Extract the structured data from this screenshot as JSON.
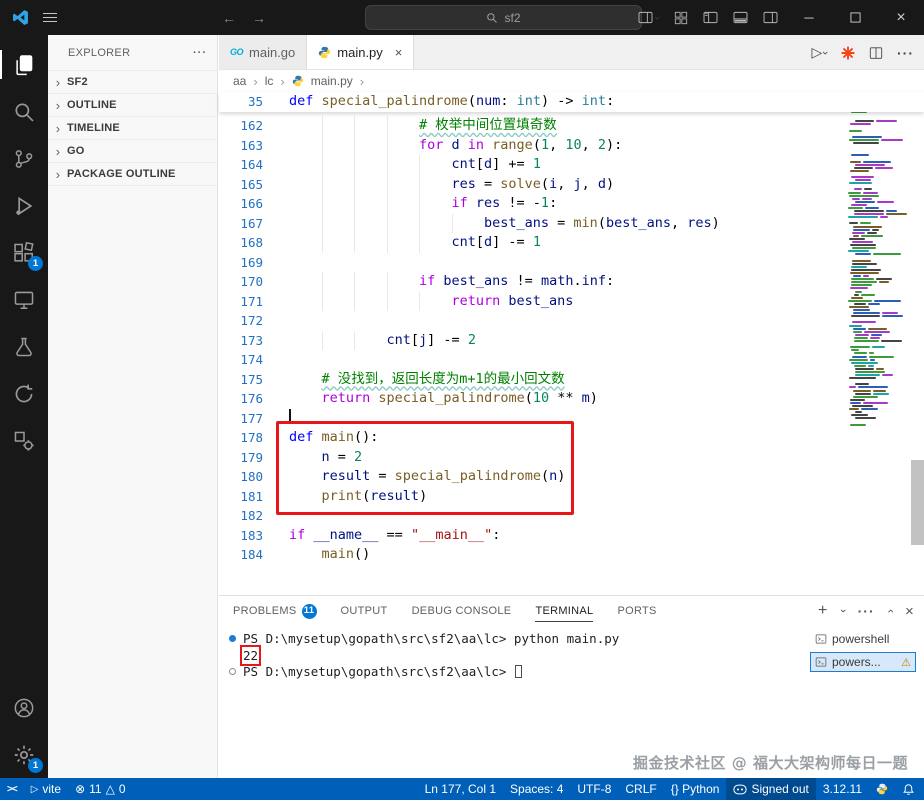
{
  "titlebar": {
    "search": "sf2"
  },
  "activity_bar": {
    "extensions_badge": "1",
    "settings_badge": "1"
  },
  "sidebar": {
    "title": "EXPLORER",
    "sections": [
      {
        "label": "SF2"
      },
      {
        "label": "OUTLINE"
      },
      {
        "label": "TIMELINE"
      },
      {
        "label": "GO"
      },
      {
        "label": "PACKAGE OUTLINE"
      }
    ]
  },
  "tabs": [
    {
      "label": "main.go",
      "icon": "go",
      "active": false
    },
    {
      "label": "main.py",
      "icon": "python",
      "active": true
    }
  ],
  "breadcrumb": {
    "items": [
      "aa",
      "lc",
      "main.py"
    ]
  },
  "editor": {
    "sticky": {
      "num": "35",
      "indent": 0,
      "tokens": [
        [
          "def ",
          "def"
        ],
        [
          "special_palindrome",
          "fn"
        ],
        [
          "(",
          "pl"
        ],
        [
          "num",
          "var"
        ],
        [
          ": ",
          "pl"
        ],
        [
          "int",
          "type"
        ],
        [
          ") ",
          "pl"
        ],
        [
          "-> ",
          "pl"
        ],
        [
          "int",
          "type"
        ],
        [
          ":",
          "pl"
        ]
      ]
    },
    "lines": [
      {
        "num": 162,
        "indent": 16,
        "tokens": [
          [
            "# 枚举中间位置填奇数",
            "com"
          ]
        ]
      },
      {
        "num": 163,
        "indent": 16,
        "tokens": [
          [
            "for ",
            "kw"
          ],
          [
            "d",
            "var"
          ],
          [
            " in ",
            "kw"
          ],
          [
            "range",
            "fn"
          ],
          [
            "(",
            "pl"
          ],
          [
            "1",
            "num"
          ],
          [
            ", ",
            "pl"
          ],
          [
            "10",
            "num"
          ],
          [
            ", ",
            "pl"
          ],
          [
            "2",
            "num"
          ],
          [
            "):",
            "pl"
          ]
        ]
      },
      {
        "num": 164,
        "indent": 20,
        "tokens": [
          [
            "cnt",
            "var"
          ],
          [
            "[",
            "pl"
          ],
          [
            "d",
            "var"
          ],
          [
            "] += ",
            "pl"
          ],
          [
            "1",
            "num"
          ]
        ]
      },
      {
        "num": 165,
        "indent": 20,
        "tokens": [
          [
            "res",
            "var"
          ],
          [
            " = ",
            "pl"
          ],
          [
            "solve",
            "fn"
          ],
          [
            "(",
            "pl"
          ],
          [
            "i",
            "var"
          ],
          [
            ", ",
            "pl"
          ],
          [
            "j",
            "var"
          ],
          [
            ", ",
            "pl"
          ],
          [
            "d",
            "var"
          ],
          [
            ")",
            "pl"
          ]
        ]
      },
      {
        "num": 166,
        "indent": 20,
        "tokens": [
          [
            "if ",
            "kw"
          ],
          [
            "res",
            "var"
          ],
          [
            " != -",
            "pl"
          ],
          [
            "1",
            "num"
          ],
          [
            ":",
            "pl"
          ]
        ]
      },
      {
        "num": 167,
        "indent": 24,
        "tokens": [
          [
            "best_ans",
            "var"
          ],
          [
            " = ",
            "pl"
          ],
          [
            "min",
            "fn"
          ],
          [
            "(",
            "pl"
          ],
          [
            "best_ans",
            "var"
          ],
          [
            ", ",
            "pl"
          ],
          [
            "res",
            "var"
          ],
          [
            ")",
            "pl"
          ]
        ]
      },
      {
        "num": 168,
        "indent": 20,
        "tokens": [
          [
            "cnt",
            "var"
          ],
          [
            "[",
            "pl"
          ],
          [
            "d",
            "var"
          ],
          [
            "] -= ",
            "pl"
          ],
          [
            "1",
            "num"
          ]
        ]
      },
      {
        "num": 169,
        "indent": 0,
        "tokens": []
      },
      {
        "num": 170,
        "indent": 16,
        "tokens": [
          [
            "if ",
            "kw"
          ],
          [
            "best_ans",
            "var"
          ],
          [
            " != ",
            "pl"
          ],
          [
            "math",
            "var"
          ],
          [
            ".",
            "pl"
          ],
          [
            "inf",
            "var"
          ],
          [
            ":",
            "pl"
          ]
        ]
      },
      {
        "num": 171,
        "indent": 20,
        "tokens": [
          [
            "return ",
            "kw"
          ],
          [
            "best_ans",
            "var"
          ]
        ]
      },
      {
        "num": 172,
        "indent": 0,
        "tokens": []
      },
      {
        "num": 173,
        "indent": 12,
        "tokens": [
          [
            "cnt",
            "var"
          ],
          [
            "[",
            "pl"
          ],
          [
            "j",
            "var"
          ],
          [
            "] -= ",
            "pl"
          ],
          [
            "2",
            "num"
          ]
        ]
      },
      {
        "num": 174,
        "indent": 0,
        "tokens": []
      },
      {
        "num": 175,
        "indent": 4,
        "tokens": [
          [
            "# 没找到，返回长度为m+1的最小回文数",
            "com"
          ]
        ]
      },
      {
        "num": 176,
        "indent": 4,
        "tokens": [
          [
            "return ",
            "kw"
          ],
          [
            "special_palindrome",
            "fn"
          ],
          [
            "(",
            "pl"
          ],
          [
            "10",
            "num"
          ],
          [
            " ** ",
            "pl"
          ],
          [
            "m",
            "var"
          ],
          [
            ")",
            "pl"
          ]
        ]
      },
      {
        "num": 177,
        "indent": 0,
        "tokens": [],
        "cursor": true
      },
      {
        "num": 178,
        "indent": 0,
        "tokens": [
          [
            "def ",
            "def"
          ],
          [
            "main",
            "fn"
          ],
          [
            "():",
            "pl"
          ]
        ]
      },
      {
        "num": 179,
        "indent": 4,
        "tokens": [
          [
            "n",
            "var"
          ],
          [
            " = ",
            "pl"
          ],
          [
            "2",
            "num"
          ]
        ]
      },
      {
        "num": 180,
        "indent": 4,
        "tokens": [
          [
            "result",
            "var"
          ],
          [
            " = ",
            "pl"
          ],
          [
            "special_palindrome",
            "fn"
          ],
          [
            "(",
            "pl"
          ],
          [
            "n",
            "var"
          ],
          [
            ")",
            "pl"
          ]
        ]
      },
      {
        "num": 181,
        "indent": 4,
        "tokens": [
          [
            "print",
            "fn"
          ],
          [
            "(",
            "pl"
          ],
          [
            "result",
            "var"
          ],
          [
            ")",
            "pl"
          ]
        ]
      },
      {
        "num": 182,
        "indent": 0,
        "tokens": []
      },
      {
        "num": 183,
        "indent": 0,
        "tokens": [
          [
            "if ",
            "kw"
          ],
          [
            "__name__",
            "var"
          ],
          [
            " == ",
            "pl"
          ],
          [
            "\"__main__\"",
            "str"
          ],
          [
            ":",
            "pl"
          ]
        ]
      },
      {
        "num": 184,
        "indent": 4,
        "tokens": [
          [
            "main",
            "fn"
          ],
          [
            "()",
            "pl"
          ]
        ]
      }
    ]
  },
  "panel": {
    "tabs": {
      "problems": "PROBLEMS",
      "output": "OUTPUT",
      "debug": "DEBUG CONSOLE",
      "terminal": "TERMINAL",
      "ports": "PORTS"
    },
    "problems_badge": "11",
    "terminal": {
      "lines": [
        {
          "decoration": "filled",
          "text": "PS D:\\mysetup\\gopath\\src\\sf2\\aa\\lc> python main.py"
        },
        {
          "decoration": "none",
          "text": "22",
          "boxed": true
        },
        {
          "decoration": "empty",
          "text": "PS D:\\mysetup\\gopath\\src\\sf2\\aa\\lc> ",
          "cursor": true
        }
      ],
      "side_items": [
        {
          "label": "powershell",
          "selected": false,
          "warning": false
        },
        {
          "label": "powers...",
          "selected": true,
          "warning": true
        }
      ]
    },
    "watermark": "掘金技术社区 @ 福大大架构师每日一题"
  },
  "status_bar": {
    "vite": "vite",
    "errors": "11",
    "warnings": "0",
    "line_col": "Ln 177, Col 1",
    "spaces": "Spaces: 4",
    "encoding": "UTF-8",
    "eol": "CRLF",
    "language": "{} Python",
    "signed": "Signed out",
    "python_version": "3.12.11"
  }
}
